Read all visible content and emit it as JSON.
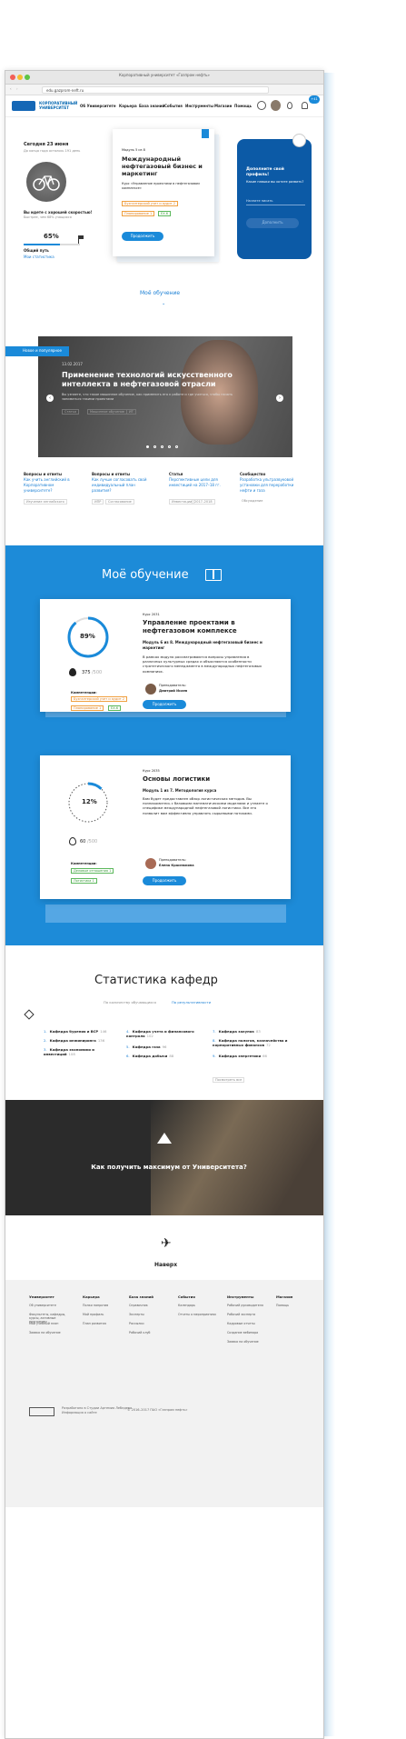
{
  "browser": {
    "title": "Корпоративный университет «Газпром нефть»",
    "url": "edu.gazprom-neft.ru"
  },
  "nav": {
    "logo": "КОРПОРАТИВНЫЙ УНИВЕРСИТЕТ",
    "items": [
      "Об Университете",
      "Карьера",
      "База знаний",
      "События",
      "Инструменты",
      "Магазин",
      "Помощь"
    ],
    "badge": "+41"
  },
  "profile": {
    "date": "Сегодня 23 июня",
    "since": "До конца года осталось 191 день",
    "question": "Вы идете с хорошей скоростью!",
    "sub": "Быстрее, чем 68% учащихся",
    "percent": "65%",
    "path_label": "Общий путь",
    "stats_link": "Мои статистика"
  },
  "featured": {
    "module": "Модуль 5 из 8",
    "title": "Международный нефтегазовый бизнес и маркетинг",
    "course": "Курс «Управление проектами в нефтегазовом комплексе»",
    "tags": [
      "Бухгалтерский учет и аудит 2",
      "Планирование 1",
      "ЕХ.6"
    ],
    "button": "Продолжить"
  },
  "prompt": {
    "title": "Дополните свой профиль!",
    "question": "Какие навыки вы хотите развить?",
    "placeholder": "Начните писать",
    "button": "Дополнить"
  },
  "my_learning_link": "Моё обучение",
  "banner": {
    "label": "Новое и популярное",
    "date": "13.02.2017",
    "title": "Применение технологий искусственного интеллекта в нефтегазовой отрасли",
    "desc": "Вы узнаете, что такое машинное обучение, как применить его к работе и где учиться, чтобы начать заниматься такими проектами",
    "tags": [
      "Статья",
      "Машинное обучение",
      "ИТ"
    ]
  },
  "news": [
    {
      "type": "Вопросы и ответы",
      "title": "Как учить английский в Корпоративном университете?",
      "tags": [
        "Изучение английского"
      ]
    },
    {
      "type": "Вопросы и ответы",
      "title": "Как лучше согласовать свой индивидуальный план развития?",
      "tags": [
        "ИПР",
        "Согласование"
      ]
    },
    {
      "type": "Статья",
      "title": "Перспективные цели для инвестиций на 2017–18 гг.",
      "tags": [
        "Инвестиции",
        "2017–2018"
      ]
    },
    {
      "type": "Сообщество",
      "title": "Разработка ультразвуковой установки для переработки нефти и газа",
      "tags": [
        "Обсуждение"
      ]
    }
  ],
  "learning": {
    "heading": "Моё обучение",
    "courses": [
      {
        "code": "Курс 2031",
        "title": "Управление проектами в нефтегазовом комплексе",
        "module": "Модуль 6 из 8. Международный нефтегазовый бизнес и маркетинг",
        "desc": "В рамках модуля рассматриваются вопросы управления в различных культурных средах и объясняются особенности стратегического менеджмента в международных нефтегазовых компаниях.",
        "percent": "89%",
        "points": "375",
        "points_total": "/500",
        "teacher_label": "Преподаватель:",
        "teacher": "Дмитрий Исаев",
        "comp_label": "Компетенции:",
        "tags": [
          "Бухгалтерский учет и аудит 2",
          "Планирование 1",
          "ЕХ.6"
        ],
        "button": "Продолжить"
      },
      {
        "code": "Курс 2035",
        "title": "Основы логистики",
        "module": "Модуль 1 из 7. Методология курса",
        "desc": "Вам будет предоставлен обзор логистических методов. Вы познакомитесь с базовыми математическими моделями и узнаете о специфике международной нефтегазовой логистики. Все это позволит вам эффективно управлять сырьевыми потоками.",
        "percent": "12%",
        "points": "60",
        "points_total": "/500",
        "teacher_label": "Преподаватель:",
        "teacher": "Елена Краснюкина",
        "comp_label": "Компетенции:",
        "tags": [
          "Деловые отношения 1",
          "Логистика 1"
        ],
        "button": "Продолжить"
      }
    ]
  },
  "stats": {
    "heading": "Статистика кафедр",
    "tab1": "По количеству обучающихся",
    "tab2": "По результативности",
    "items": [
      {
        "n": "1.",
        "name": "Кафедра бурения и ВСР",
        "v": "146"
      },
      {
        "n": "2.",
        "name": "Кафедра инжиниринга",
        "v": "136"
      },
      {
        "n": "3.",
        "name": "Кафедра экономики и инвестиций",
        "v": "108"
      },
      {
        "n": "4.",
        "name": "Кафедра учета и финансового контроля",
        "v": "102"
      },
      {
        "n": "5.",
        "name": "Кафедра газа",
        "v": "96"
      },
      {
        "n": "6.",
        "name": "Кафедра добычи",
        "v": "88"
      },
      {
        "n": "7.",
        "name": "Кафедра закупок",
        "v": "83"
      },
      {
        "n": "8.",
        "name": "Кафедра налогов, казначейства и корпоративных финансов",
        "v": "72"
      },
      {
        "n": "9.",
        "name": "Кафедра энергетики",
        "v": "66"
      }
    ],
    "more": "Посмотреть все"
  },
  "promo": {
    "title": "Как получить максимум от Университета?"
  },
  "up": "Наверх",
  "footer": {
    "cols": [
      {
        "title": "Университет",
        "items": [
          "Об университете",
          "Факультеты, кафедры, курсы, активные программы",
          "Мой учебный план",
          "Заявка на обучение"
        ]
      },
      {
        "title": "Карьера",
        "items": [
          "Полки напротив",
          "Мой профиль",
          "План развития"
        ]
      },
      {
        "title": "База знаний",
        "items": [
          "Справочник",
          "Эксперты",
          "Рассылки",
          "Рабочий клуб"
        ]
      },
      {
        "title": "События",
        "items": [
          "Календарь",
          "Отчеты о мероприятиях"
        ]
      },
      {
        "title": "Инструменты",
        "items": [
          "Рабочий руководителя",
          "Рабочий эксперта",
          "Кадровые отчеты",
          "Создание вебинара",
          "Заявка на обучение"
        ]
      },
      {
        "title": "Магазин",
        "items": [
          "Помощь"
        ]
      }
    ],
    "company": "Разработано в Студии Артемия Лебедева",
    "company2": "Информация о сайте",
    "copyright": "© 2016–2017 ПАО «Газпром нефть»"
  }
}
